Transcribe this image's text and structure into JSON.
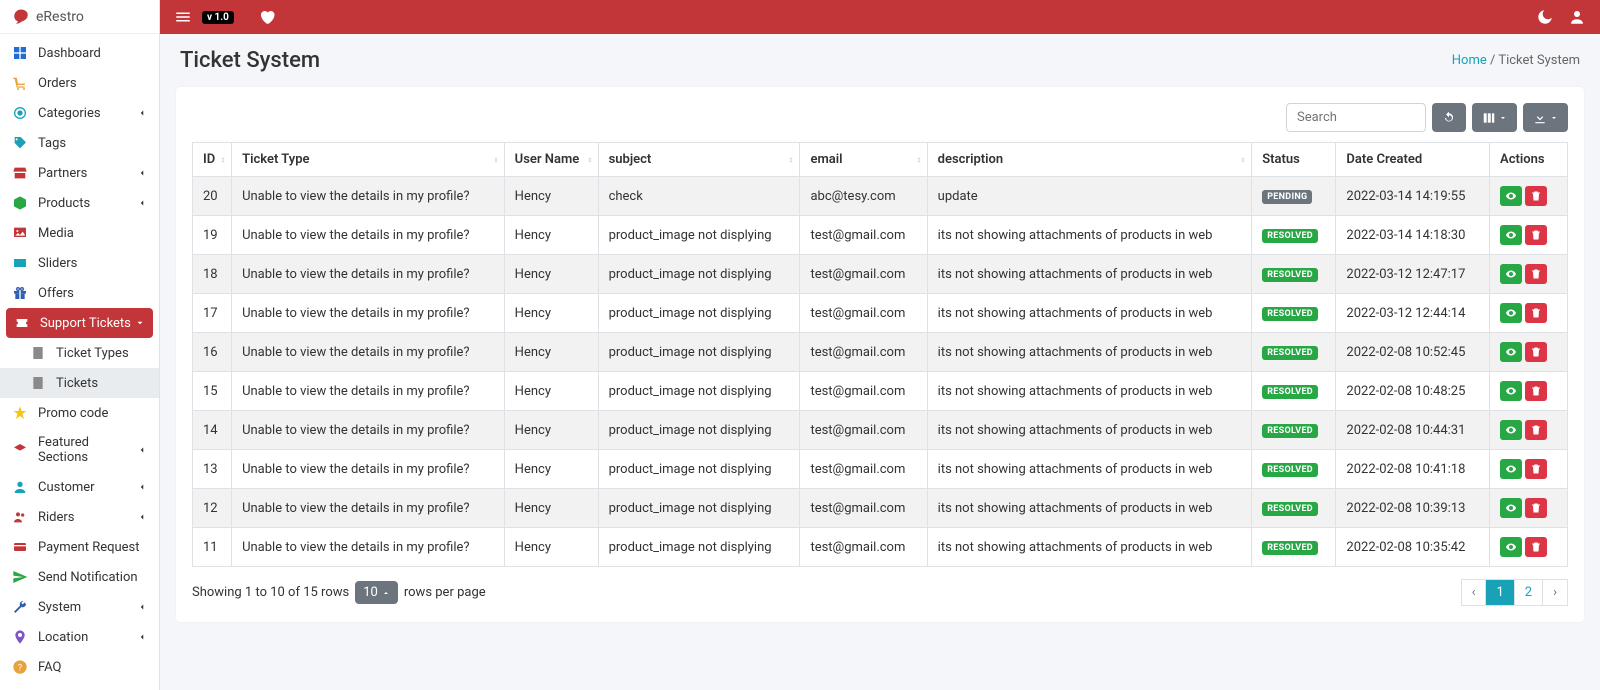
{
  "brand": {
    "name": "eRestro"
  },
  "topbar": {
    "version": "v 1.0"
  },
  "sidebar": {
    "items": [
      {
        "label": "Dashboard"
      },
      {
        "label": "Orders"
      },
      {
        "label": "Categories"
      },
      {
        "label": "Tags"
      },
      {
        "label": "Partners"
      },
      {
        "label": "Products"
      },
      {
        "label": "Media"
      },
      {
        "label": "Sliders"
      },
      {
        "label": "Offers"
      },
      {
        "label": "Support Tickets"
      },
      {
        "label": "Promo code"
      },
      {
        "label": "Featured Sections"
      },
      {
        "label": "Customer"
      },
      {
        "label": "Riders"
      },
      {
        "label": "Payment Request"
      },
      {
        "label": "Send Notification"
      },
      {
        "label": "System"
      },
      {
        "label": "Location"
      },
      {
        "label": "FAQ"
      }
    ],
    "sub": {
      "ticket_types": "Ticket Types",
      "tickets": "Tickets"
    }
  },
  "header": {
    "title": "Ticket System",
    "breadcrumb": {
      "home": "Home",
      "current": "Ticket System"
    }
  },
  "toolbar": {
    "search_placeholder": "Search"
  },
  "table": {
    "columns": [
      "ID",
      "Ticket Type",
      "User Name",
      "subject",
      "email",
      "description",
      "Status",
      "Date Created",
      "Actions"
    ],
    "rows": [
      {
        "id": "20",
        "type": "Unable to view the details in my profile?",
        "user": "Hency",
        "subject": "check",
        "email": "abc@tesy.com",
        "description": "update",
        "status": "PENDING",
        "status_class": "pending",
        "date": "2022-03-14 14:19:55"
      },
      {
        "id": "19",
        "type": "Unable to view the details in my profile?",
        "user": "Hency",
        "subject": "product_image not displying",
        "email": "test@gmail.com",
        "description": "its not showing attachments of products in web",
        "status": "RESOLVED",
        "status_class": "resolved",
        "date": "2022-03-14 14:18:30"
      },
      {
        "id": "18",
        "type": "Unable to view the details in my profile?",
        "user": "Hency",
        "subject": "product_image not displying",
        "email": "test@gmail.com",
        "description": "its not showing attachments of products in web",
        "status": "RESOLVED",
        "status_class": "resolved",
        "date": "2022-03-12 12:47:17"
      },
      {
        "id": "17",
        "type": "Unable to view the details in my profile?",
        "user": "Hency",
        "subject": "product_image not displying",
        "email": "test@gmail.com",
        "description": "its not showing attachments of products in web",
        "status": "RESOLVED",
        "status_class": "resolved",
        "date": "2022-03-12 12:44:14"
      },
      {
        "id": "16",
        "type": "Unable to view the details in my profile?",
        "user": "Hency",
        "subject": "product_image not displying",
        "email": "test@gmail.com",
        "description": "its not showing attachments of products in web",
        "status": "RESOLVED",
        "status_class": "resolved",
        "date": "2022-02-08 10:52:45"
      },
      {
        "id": "15",
        "type": "Unable to view the details in my profile?",
        "user": "Hency",
        "subject": "product_image not displying",
        "email": "test@gmail.com",
        "description": "its not showing attachments of products in web",
        "status": "RESOLVED",
        "status_class": "resolved",
        "date": "2022-02-08 10:48:25"
      },
      {
        "id": "14",
        "type": "Unable to view the details in my profile?",
        "user": "Hency",
        "subject": "product_image not displying",
        "email": "test@gmail.com",
        "description": "its not showing attachments of products in web",
        "status": "RESOLVED",
        "status_class": "resolved",
        "date": "2022-02-08 10:44:31"
      },
      {
        "id": "13",
        "type": "Unable to view the details in my profile?",
        "user": "Hency",
        "subject": "product_image not displying",
        "email": "test@gmail.com",
        "description": "its not showing attachments of products in web",
        "status": "RESOLVED",
        "status_class": "resolved",
        "date": "2022-02-08 10:41:18"
      },
      {
        "id": "12",
        "type": "Unable to view the details in my profile?",
        "user": "Hency",
        "subject": "product_image not displying",
        "email": "test@gmail.com",
        "description": "its not showing attachments of products in web",
        "status": "RESOLVED",
        "status_class": "resolved",
        "date": "2022-02-08 10:39:13"
      },
      {
        "id": "11",
        "type": "Unable to view the details in my profile?",
        "user": "Hency",
        "subject": "product_image not displying",
        "email": "test@gmail.com",
        "description": "its not showing attachments of products in web",
        "status": "RESOLVED",
        "status_class": "resolved",
        "date": "2022-02-08 10:35:42"
      }
    ]
  },
  "footer": {
    "showing_prefix": "Showing 1 to 10 of 15 rows",
    "page_size": "10",
    "rows_suffix": "rows per page",
    "pages": [
      "1",
      "2"
    ]
  }
}
